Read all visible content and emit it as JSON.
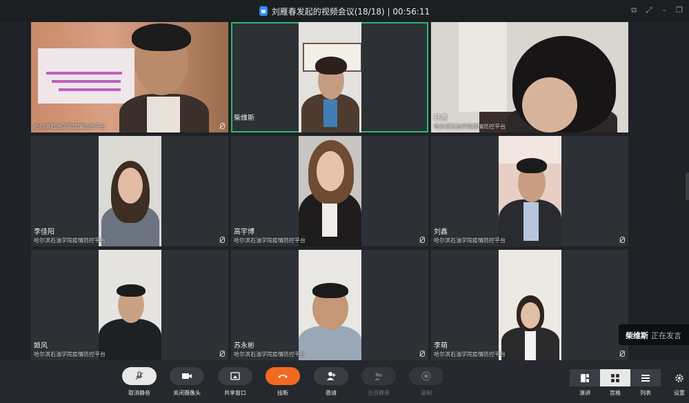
{
  "window": {
    "title": "刘雁春发起的视频会议(18/18) | 00:56:11",
    "controls": [
      "popout-icon",
      "fullscreen-icon",
      "minimize-icon",
      "restore-icon"
    ]
  },
  "participants": [
    {
      "name": "",
      "org": "哈尔滨石油学院疫情防控平台",
      "active": false,
      "muted": true
    },
    {
      "name": "柴维斯",
      "org": "",
      "active": true,
      "muted": false
    },
    {
      "name": "韩蕾",
      "org": "哈尔滨石油学院疫情防控平台",
      "active": false,
      "muted": true
    },
    {
      "name": "李佳阳",
      "org": "哈尔滨石油学院疫情防控平台",
      "active": false,
      "muted": true
    },
    {
      "name": "高宇博",
      "org": "哈尔滨石油学院疫情防控平台",
      "active": false,
      "muted": true
    },
    {
      "name": "刘鑫",
      "org": "哈尔滨石油学院疫情防控平台",
      "active": false,
      "muted": true
    },
    {
      "name": "姬风",
      "org": "哈尔滨石油学院疫情防控平台",
      "active": false,
      "muted": true
    },
    {
      "name": "苏永彬",
      "org": "哈尔滨石油学院疫情防控平台",
      "active": false,
      "muted": true
    },
    {
      "name": "李萌",
      "org": "哈尔滨石油学院疫情防控平台",
      "active": false,
      "muted": true
    }
  ],
  "speaking": {
    "name": "柴维斯",
    "status": "正在发言"
  },
  "toolbar": {
    "unmute": "取消静音",
    "camera_off": "关闭摄像头",
    "share": "共享窗口",
    "hangup": "挂断",
    "invite": "邀请",
    "mute_all": "全员静音",
    "record": "录制"
  },
  "views": {
    "speaker": "演讲",
    "gallery": "宫格",
    "list": "列表",
    "settings": "设置",
    "selected": "gallery"
  },
  "colors": {
    "active_border": "#2db672",
    "hangup": "#f26a22",
    "lock": "#2f8cff"
  }
}
